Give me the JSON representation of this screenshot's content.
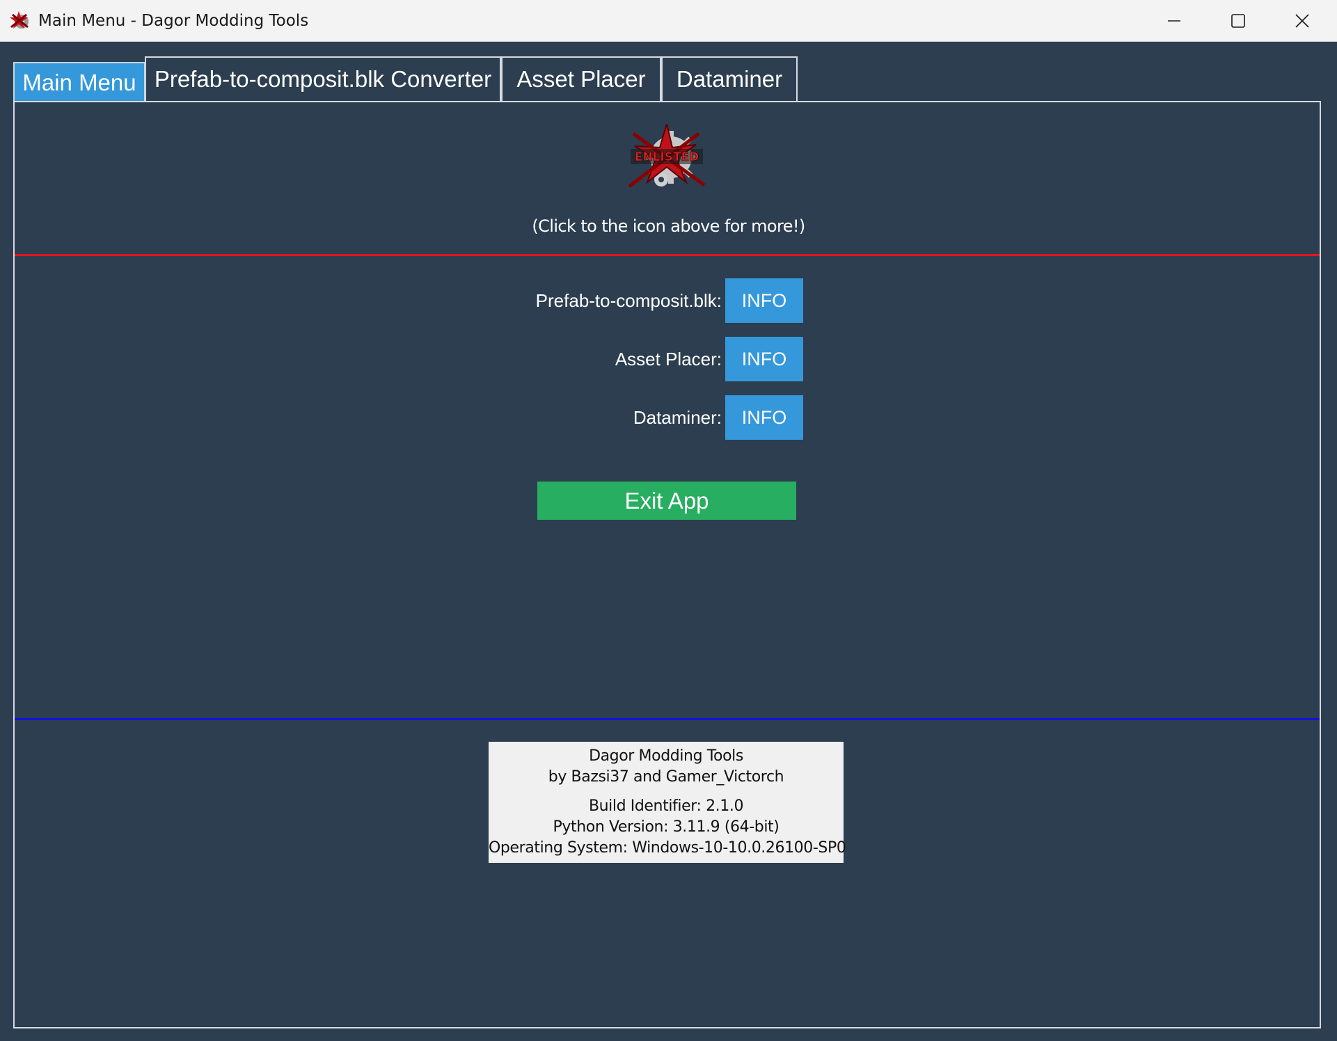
{
  "window": {
    "title": "Main Menu - Dagor Modding Tools",
    "icon": "gear-star-logo-icon"
  },
  "tabs": [
    {
      "label": "Main Menu",
      "active": true
    },
    {
      "label": "Prefab-to-composit.blk Converter",
      "active": false
    },
    {
      "label": "Asset Placer",
      "active": false
    },
    {
      "label": "Dataminer",
      "active": false
    }
  ],
  "main": {
    "logo_text": "ENLISTED",
    "hint": "(Click to the icon above for more!)",
    "info_rows": [
      {
        "label": "Prefab-to-composit.blk:",
        "button": "INFO"
      },
      {
        "label": "Asset Placer:",
        "button": "INFO"
      },
      {
        "label": "Dataminer:",
        "button": "INFO"
      }
    ],
    "exit_label": "Exit App"
  },
  "about": {
    "app_name": "Dagor Modding Tools",
    "authors": "by Bazsi37 and Gamer_Victorch",
    "build": "Build Identifier: 2.1.0",
    "python": "Python Version: 3.11.9 (64-bit)",
    "os": "Operating System: Windows-10-10.0.26100-SP0"
  },
  "colors": {
    "background": "#2c3e50",
    "accent_blue": "#3498db",
    "exit_green": "#27ae60",
    "separator_red": "#e0171f",
    "separator_blue": "#1111dd"
  }
}
